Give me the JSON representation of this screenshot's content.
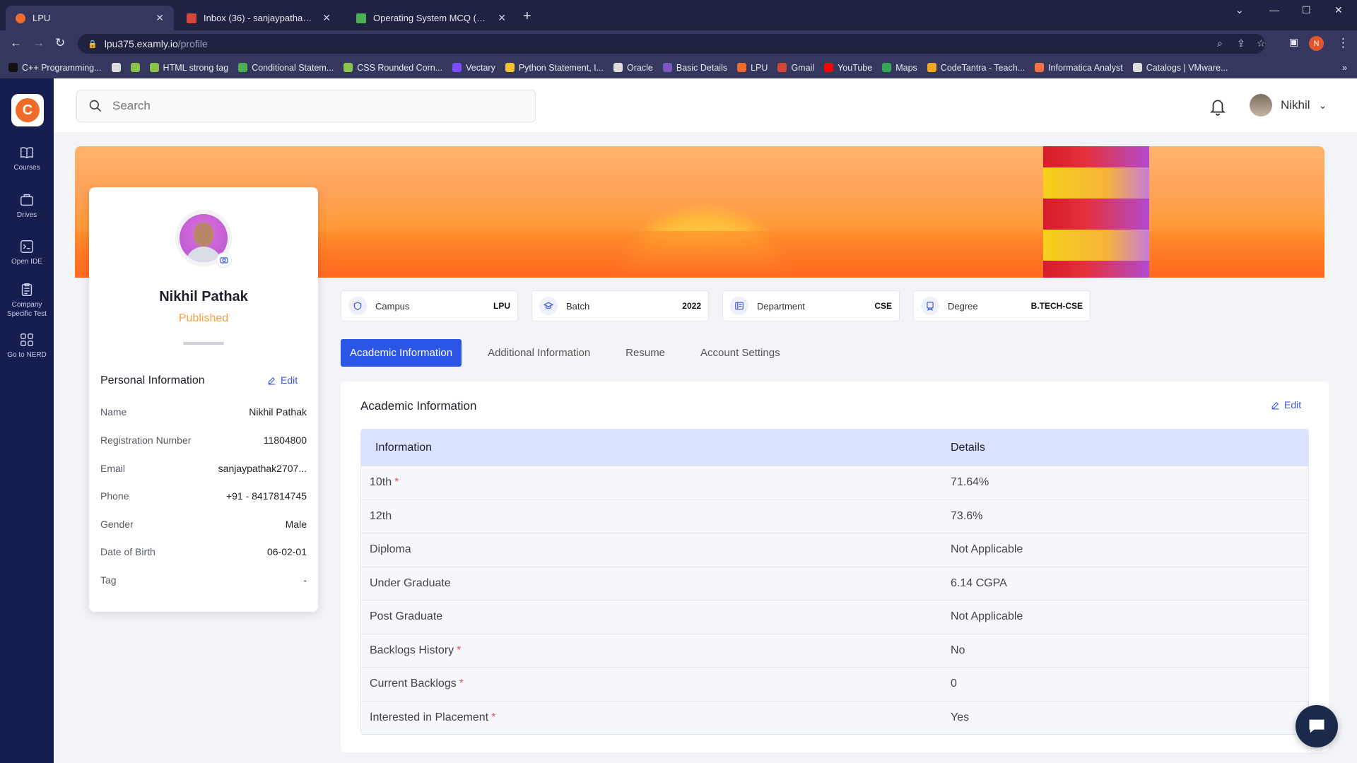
{
  "browser": {
    "tabs": [
      {
        "title": "LPU",
        "favicon_color": "#f06a2a"
      },
      {
        "title": "Inbox (36) - sanjaypathak2707@...",
        "favicon_color": "#d44638"
      },
      {
        "title": "Operating System MCQ (Multiple...",
        "favicon_color": "#4caf50"
      }
    ],
    "url_host": "lpu375.examly.io",
    "url_path": "/profile",
    "profile_initial": "N",
    "bookmarks": [
      {
        "label": "C++ Programming...",
        "color": "#111111"
      },
      {
        "label": "",
        "color": "#dddddd"
      },
      {
        "label": "",
        "color": "#8bc34a"
      },
      {
        "label": "HTML strong tag",
        "color": "#8bc34a"
      },
      {
        "label": "Conditional Statem...",
        "color": "#4caf50"
      },
      {
        "label": "CSS Rounded Corn...",
        "color": "#8bc34a"
      },
      {
        "label": "Vectary",
        "color": "#7c4dff"
      },
      {
        "label": "Python Statement, I...",
        "color": "#f4c430"
      },
      {
        "label": "Oracle",
        "color": "#dddddd"
      },
      {
        "label": "Basic Details",
        "color": "#7e57c2"
      },
      {
        "label": "LPU",
        "color": "#f06a2a"
      },
      {
        "label": "Gmail",
        "color": "#d44638"
      },
      {
        "label": "YouTube",
        "color": "#ff0000"
      },
      {
        "label": "Maps",
        "color": "#34a853"
      },
      {
        "label": "CodeTantra - Teach...",
        "color": "#f5a623"
      },
      {
        "label": "Informatica Analyst",
        "color": "#ff7043"
      },
      {
        "label": "Catalogs | VMware...",
        "color": "#dddddd"
      }
    ]
  },
  "sidebar": {
    "items": [
      {
        "label": "Courses",
        "icon": "book-icon"
      },
      {
        "label": "Drives",
        "icon": "briefcase-icon"
      },
      {
        "label": "Open IDE",
        "icon": "terminal-icon"
      },
      {
        "label": "Company Specific Test",
        "icon": "clipboard-icon"
      },
      {
        "label": "Go to NERD",
        "icon": "grid-icon"
      }
    ]
  },
  "header": {
    "search_placeholder": "Search",
    "user_name": "Nikhil"
  },
  "profile": {
    "name": "Nikhil Pathak",
    "status": "Published",
    "section_title": "Personal Information",
    "edit_label": "Edit",
    "fields": [
      {
        "label": "Name",
        "value": "Nikhil Pathak"
      },
      {
        "label": "Registration Number",
        "value": "11804800"
      },
      {
        "label": "Email",
        "value": "sanjaypathak2707..."
      },
      {
        "label": "Phone",
        "value": "+91 - 8417814745"
      },
      {
        "label": "Gender",
        "value": "Male"
      },
      {
        "label": "Date of Birth",
        "value": "06-02-01"
      },
      {
        "label": "Tag",
        "value": "-"
      }
    ]
  },
  "chips": [
    {
      "label": "Campus",
      "value": "LPU",
      "icon": "campus-icon"
    },
    {
      "label": "Batch",
      "value": "2022",
      "icon": "batch-icon"
    },
    {
      "label": "Department",
      "value": "CSE",
      "icon": "department-icon"
    },
    {
      "label": "Degree",
      "value": "B.TECH-CSE",
      "icon": "degree-icon"
    }
  ],
  "tabs": [
    {
      "label": "Academic Information",
      "active": true
    },
    {
      "label": "Additional Information",
      "active": false
    },
    {
      "label": "Resume",
      "active": false
    },
    {
      "label": "Account Settings",
      "active": false
    }
  ],
  "academic": {
    "title": "Academic Information",
    "edit_label": "Edit",
    "columns": [
      "Information",
      "Details"
    ],
    "rows": [
      {
        "info": "10th",
        "required": true,
        "details": "71.64%"
      },
      {
        "info": "12th",
        "required": false,
        "details": "73.6%"
      },
      {
        "info": "Diploma",
        "required": false,
        "details": "Not Applicable"
      },
      {
        "info": "Under Graduate",
        "required": false,
        "details": "6.14 CGPA"
      },
      {
        "info": "Post Graduate",
        "required": false,
        "details": "Not Applicable"
      },
      {
        "info": "Backlogs History",
        "required": true,
        "details": "No"
      },
      {
        "info": "Current Backlogs",
        "required": true,
        "details": "0"
      },
      {
        "info": "Interested in Placement",
        "required": true,
        "details": "Yes"
      }
    ],
    "required_marker": "*"
  },
  "colors": {
    "accent": "#2b55e6",
    "sidebar_bg": "#161d4f",
    "status_published": "#f6a13a",
    "table_header_bg": "#dbe3ff"
  }
}
